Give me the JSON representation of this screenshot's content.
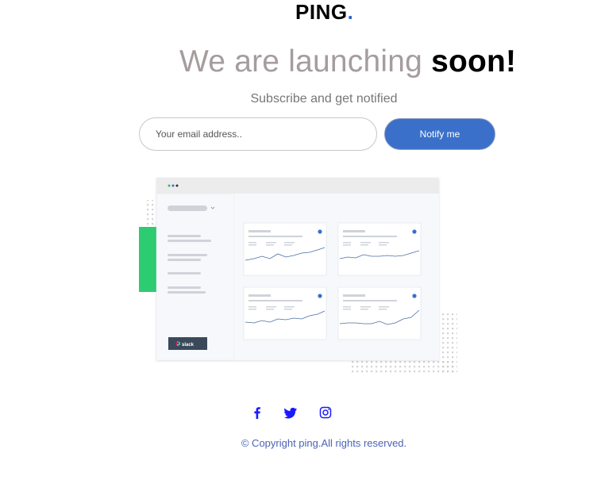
{
  "brand": {
    "name": "PING",
    "dot": "."
  },
  "hero": {
    "headline_light": "We are launching",
    "headline_bold": "soon!",
    "subtitle": "Subscribe and get notified"
  },
  "form": {
    "email_placeholder": "Your email address..",
    "email_value": "",
    "notify_label": "Notify me"
  },
  "illustration": {
    "slack_label": "slack"
  },
  "social": [
    {
      "name": "facebook-icon"
    },
    {
      "name": "twitter-icon"
    },
    {
      "name": "instagram-icon"
    }
  ],
  "footer": {
    "copyright": "© Copyright ping.All rights reserved."
  },
  "colors": {
    "accent": "#3a70c9",
    "heading_light": "#a59d9d",
    "green_block": "#2ecc71",
    "social_icon": "#1a1aff"
  }
}
